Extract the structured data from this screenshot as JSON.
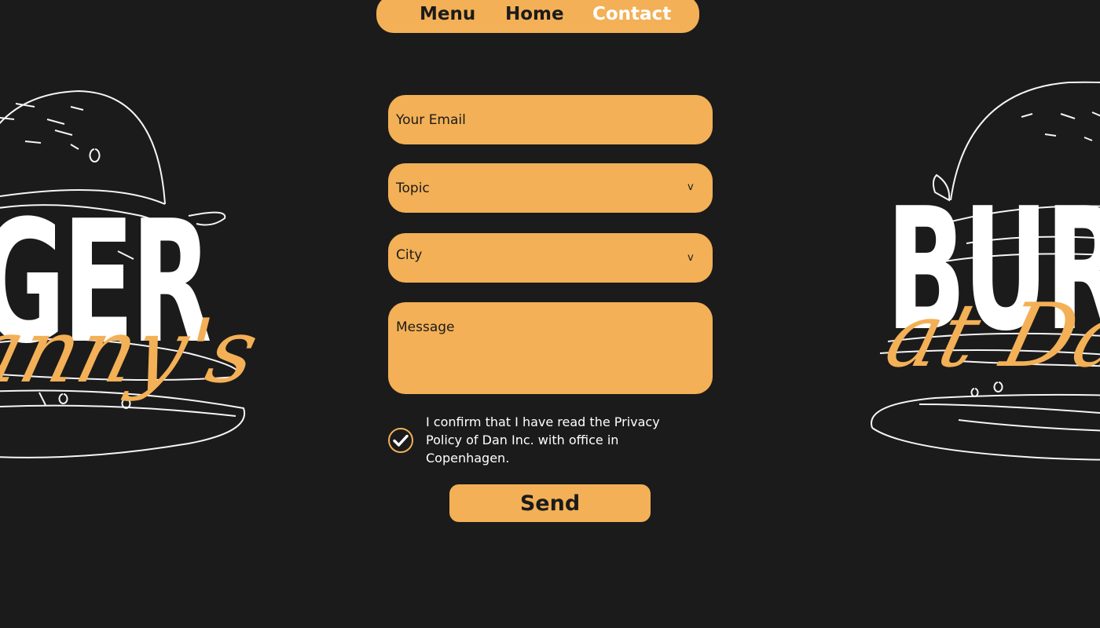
{
  "colors": {
    "background": "#1b1b1b",
    "accent": "#f3b056",
    "text_light": "#ffffff",
    "text_dark": "#1b1b1b"
  },
  "nav": {
    "items": [
      {
        "label": "Menu"
      },
      {
        "label": "Home"
      },
      {
        "label": "Contact",
        "active": true
      }
    ]
  },
  "decor": {
    "left_big_word": "GER",
    "left_script_word": "anny's",
    "right_big_word": "BUR",
    "right_script_word": "at Da",
    "icon": "burger-outline-icon"
  },
  "form": {
    "email": {
      "placeholder": "Your Email",
      "value": ""
    },
    "topic": {
      "label": "Topic",
      "chevron": "v"
    },
    "city": {
      "label": "City",
      "chevron": "v"
    },
    "message": {
      "placeholder": "Message",
      "value": ""
    },
    "consent": {
      "checked": true,
      "icon": "check-circle-icon",
      "text": "I confirm that I have read the Privacy Policy of Dan Inc. with office in Copenhagen."
    },
    "send_label": "Send"
  }
}
